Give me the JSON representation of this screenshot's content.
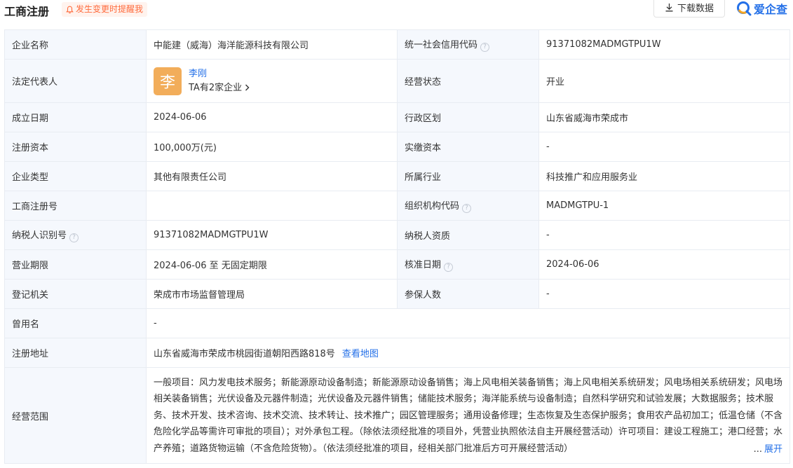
{
  "header": {
    "title": "工商注册",
    "remind_label": "发生变更时提醒我",
    "download_label": "下载数据",
    "logo_text": "爱企查"
  },
  "rows": {
    "r1": {
      "l1": "企业名称",
      "v1": "中能建（威海）海洋能源科技有限公司",
      "l2": "统一社会信用代码",
      "v2": "91371082MADMGTPU1W"
    },
    "r2": {
      "l1": "法定代表人",
      "avatar_char": "李",
      "rep_name": "李刚",
      "rep_sub": "TA有2家企业",
      "l2": "经营状态",
      "v2": "开业"
    },
    "r3": {
      "l1": "成立日期",
      "v1": "2024-06-06",
      "l2": "行政区划",
      "v2": "山东省威海市荣成市"
    },
    "r4": {
      "l1": "注册资本",
      "v1": "100,000万(元)",
      "l2": "实缴资本",
      "v2": "-"
    },
    "r5": {
      "l1": "企业类型",
      "v1": "其他有限责任公司",
      "l2": "所属行业",
      "v2": "科技推广和应用服务业"
    },
    "r6": {
      "l1": "工商注册号",
      "v1": "",
      "l2": "组织机构代码",
      "v2": "MADMGTPU-1"
    },
    "r7": {
      "l1": "纳税人识别号",
      "v1": "91371082MADMGTPU1W",
      "l2": "纳税人资质",
      "v2": "-"
    },
    "r8": {
      "l1": "营业期限",
      "v1": "2024-06-06 至 无固定期限",
      "l2": "核准日期",
      "v2": "2024-06-06"
    },
    "r9": {
      "l1": "登记机关",
      "v1": "荣成市市场监督管理局",
      "l2": "参保人数",
      "v2": "-"
    },
    "r10": {
      "l1": "曾用名",
      "v1": "-"
    },
    "r11": {
      "l1": "注册地址",
      "v1": "山东省威海市荣成市桃园街道朝阳西路818号",
      "link": "查看地图"
    },
    "r12": {
      "l1": "经营范围",
      "v1": "一般项目：风力发电技术服务；新能源原动设备制造；新能源原动设备销售；海上风电相关装备销售；海上风电相关系统研发；风电场相关系统研发；风电场相关装备销售；光伏设备及元器件制造；光伏设备及元器件销售；储能技术服务；海洋能系统与设备制造；自然科学研究和试验发展；大数据服务；技术服务、技术开发、技术咨询、技术交流、技术转让、技术推广；园区管理服务；通用设备修理；生态恢复及生态保护服务；食用农产品初加工；低温仓储（不含危险化学品等需许可审批的项目）；对外承包工程。（除依法须经批准的项目外，凭营业执照依法自主开展经营活动）许可项目：建设工程施工；港口经营；水产养殖；道路货物运输（不含危险货物）。（依法须经批准的项目，经相关部门批准后方可开展经营活动）",
      "ellipsis": "...",
      "expand_label": "展开"
    }
  },
  "help_mark": "?",
  "colors": {
    "accent": "#2470e8",
    "remind": "#ff6b3d",
    "label_bg": "#f5f8fd",
    "avatar_bg": "#f2ad5a"
  }
}
